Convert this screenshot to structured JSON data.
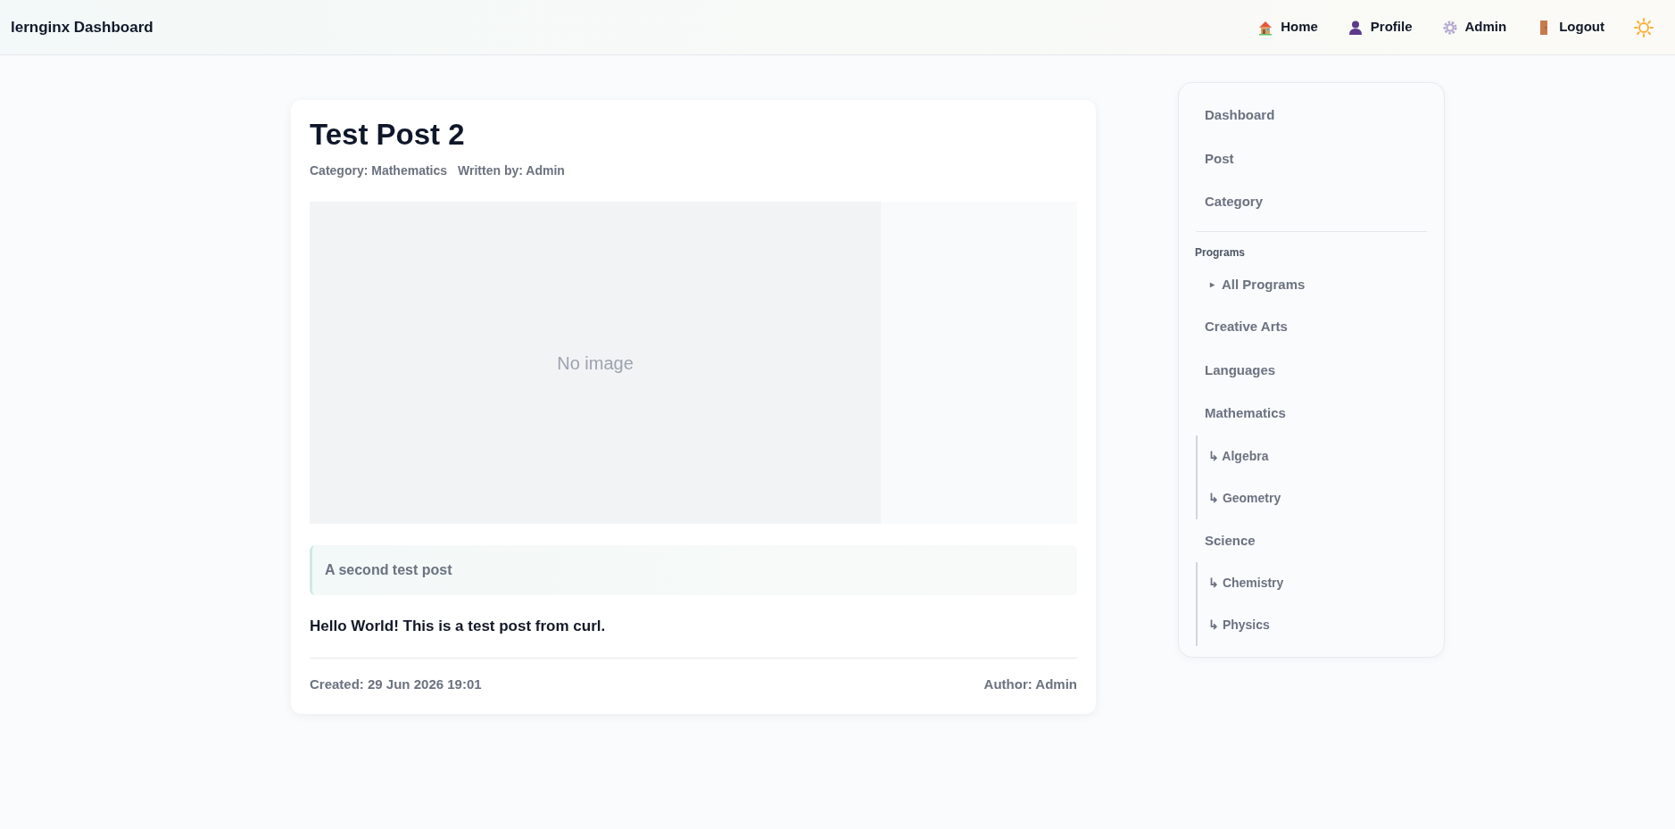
{
  "header": {
    "brand": "lernginx Dashboard",
    "nav": [
      {
        "label": "Home"
      },
      {
        "label": "Profile"
      },
      {
        "label": "Admin"
      },
      {
        "label": "Logout"
      }
    ]
  },
  "post": {
    "title": "Test Post 2",
    "category": "Category: Mathematics",
    "written_by": "Written by: Admin",
    "image_placeholder": "No image",
    "summary": "A second test post",
    "body": "Hello World! This is a test post from curl.",
    "created": "Created: 29 Jun 2026 19:01",
    "author": "Author: Admin"
  },
  "sidebar": {
    "items": [
      {
        "label": "Dashboard"
      },
      {
        "label": "Post"
      },
      {
        "label": "Category"
      }
    ],
    "section": "Programs",
    "all_programs": {
      "caret": "▸",
      "label": "All Programs"
    },
    "programs": [
      {
        "label": "Creative Arts"
      },
      {
        "label": "Languages"
      },
      {
        "label": "Mathematics",
        "children": [
          {
            "label": "↳ Algebra"
          },
          {
            "label": "↳ Geometry"
          }
        ]
      },
      {
        "label": "Science",
        "children": [
          {
            "label": "↳ Chemistry"
          },
          {
            "label": "↳ Physics"
          }
        ]
      }
    ]
  }
}
